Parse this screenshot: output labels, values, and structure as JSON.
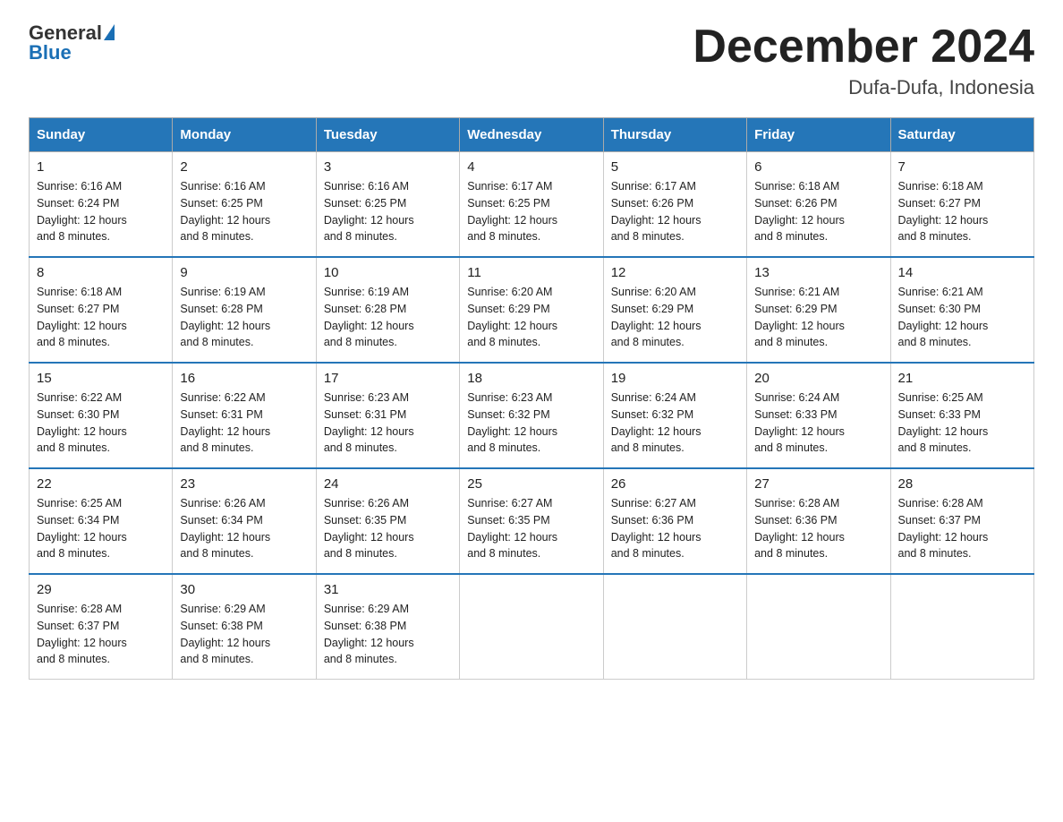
{
  "header": {
    "logo_general": "General",
    "logo_blue": "Blue",
    "title": "December 2024",
    "subtitle": "Dufa-Dufa, Indonesia"
  },
  "days_of_week": [
    "Sunday",
    "Monday",
    "Tuesday",
    "Wednesday",
    "Thursday",
    "Friday",
    "Saturday"
  ],
  "weeks": [
    [
      {
        "day": "1",
        "sunrise": "6:16 AM",
        "sunset": "6:24 PM",
        "daylight": "12 hours and 8 minutes."
      },
      {
        "day": "2",
        "sunrise": "6:16 AM",
        "sunset": "6:25 PM",
        "daylight": "12 hours and 8 minutes."
      },
      {
        "day": "3",
        "sunrise": "6:16 AM",
        "sunset": "6:25 PM",
        "daylight": "12 hours and 8 minutes."
      },
      {
        "day": "4",
        "sunrise": "6:17 AM",
        "sunset": "6:25 PM",
        "daylight": "12 hours and 8 minutes."
      },
      {
        "day": "5",
        "sunrise": "6:17 AM",
        "sunset": "6:26 PM",
        "daylight": "12 hours and 8 minutes."
      },
      {
        "day": "6",
        "sunrise": "6:18 AM",
        "sunset": "6:26 PM",
        "daylight": "12 hours and 8 minutes."
      },
      {
        "day": "7",
        "sunrise": "6:18 AM",
        "sunset": "6:27 PM",
        "daylight": "12 hours and 8 minutes."
      }
    ],
    [
      {
        "day": "8",
        "sunrise": "6:18 AM",
        "sunset": "6:27 PM",
        "daylight": "12 hours and 8 minutes."
      },
      {
        "day": "9",
        "sunrise": "6:19 AM",
        "sunset": "6:28 PM",
        "daylight": "12 hours and 8 minutes."
      },
      {
        "day": "10",
        "sunrise": "6:19 AM",
        "sunset": "6:28 PM",
        "daylight": "12 hours and 8 minutes."
      },
      {
        "day": "11",
        "sunrise": "6:20 AM",
        "sunset": "6:29 PM",
        "daylight": "12 hours and 8 minutes."
      },
      {
        "day": "12",
        "sunrise": "6:20 AM",
        "sunset": "6:29 PM",
        "daylight": "12 hours and 8 minutes."
      },
      {
        "day": "13",
        "sunrise": "6:21 AM",
        "sunset": "6:29 PM",
        "daylight": "12 hours and 8 minutes."
      },
      {
        "day": "14",
        "sunrise": "6:21 AM",
        "sunset": "6:30 PM",
        "daylight": "12 hours and 8 minutes."
      }
    ],
    [
      {
        "day": "15",
        "sunrise": "6:22 AM",
        "sunset": "6:30 PM",
        "daylight": "12 hours and 8 minutes."
      },
      {
        "day": "16",
        "sunrise": "6:22 AM",
        "sunset": "6:31 PM",
        "daylight": "12 hours and 8 minutes."
      },
      {
        "day": "17",
        "sunrise": "6:23 AM",
        "sunset": "6:31 PM",
        "daylight": "12 hours and 8 minutes."
      },
      {
        "day": "18",
        "sunrise": "6:23 AM",
        "sunset": "6:32 PM",
        "daylight": "12 hours and 8 minutes."
      },
      {
        "day": "19",
        "sunrise": "6:24 AM",
        "sunset": "6:32 PM",
        "daylight": "12 hours and 8 minutes."
      },
      {
        "day": "20",
        "sunrise": "6:24 AM",
        "sunset": "6:33 PM",
        "daylight": "12 hours and 8 minutes."
      },
      {
        "day": "21",
        "sunrise": "6:25 AM",
        "sunset": "6:33 PM",
        "daylight": "12 hours and 8 minutes."
      }
    ],
    [
      {
        "day": "22",
        "sunrise": "6:25 AM",
        "sunset": "6:34 PM",
        "daylight": "12 hours and 8 minutes."
      },
      {
        "day": "23",
        "sunrise": "6:26 AM",
        "sunset": "6:34 PM",
        "daylight": "12 hours and 8 minutes."
      },
      {
        "day": "24",
        "sunrise": "6:26 AM",
        "sunset": "6:35 PM",
        "daylight": "12 hours and 8 minutes."
      },
      {
        "day": "25",
        "sunrise": "6:27 AM",
        "sunset": "6:35 PM",
        "daylight": "12 hours and 8 minutes."
      },
      {
        "day": "26",
        "sunrise": "6:27 AM",
        "sunset": "6:36 PM",
        "daylight": "12 hours and 8 minutes."
      },
      {
        "day": "27",
        "sunrise": "6:28 AM",
        "sunset": "6:36 PM",
        "daylight": "12 hours and 8 minutes."
      },
      {
        "day": "28",
        "sunrise": "6:28 AM",
        "sunset": "6:37 PM",
        "daylight": "12 hours and 8 minutes."
      }
    ],
    [
      {
        "day": "29",
        "sunrise": "6:28 AM",
        "sunset": "6:37 PM",
        "daylight": "12 hours and 8 minutes."
      },
      {
        "day": "30",
        "sunrise": "6:29 AM",
        "sunset": "6:38 PM",
        "daylight": "12 hours and 8 minutes."
      },
      {
        "day": "31",
        "sunrise": "6:29 AM",
        "sunset": "6:38 PM",
        "daylight": "12 hours and 8 minutes."
      },
      null,
      null,
      null,
      null
    ]
  ],
  "labels": {
    "sunrise_prefix": "Sunrise: ",
    "sunset_prefix": "Sunset: ",
    "daylight_prefix": "Daylight: "
  }
}
